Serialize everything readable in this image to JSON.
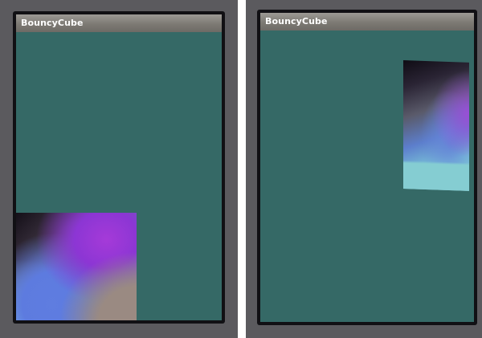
{
  "screens": [
    {
      "app_title": "BouncyCube",
      "cube_position": "bottom-left"
    },
    {
      "app_title": "BouncyCube",
      "cube_position": "right-edge"
    }
  ],
  "colors": {
    "device_frame": "#5b5a5e",
    "screen_background": "#356966",
    "title_bar": "#8a8782",
    "title_text": "#ffffff",
    "cube_purple": "#a53ad8",
    "cube_blue": "#5f7de0",
    "cube_cyan": "#85cdd2"
  }
}
